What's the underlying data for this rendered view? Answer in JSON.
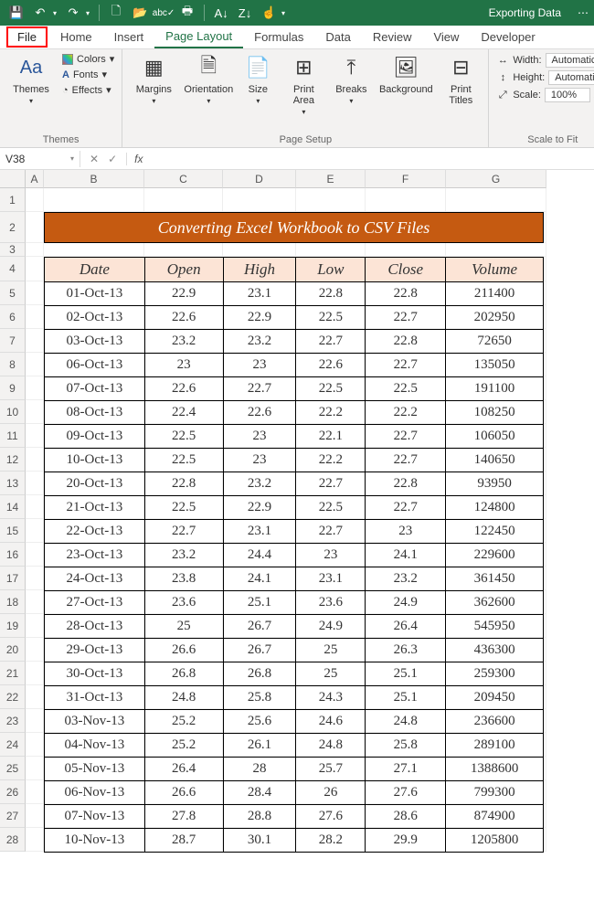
{
  "workbook_name": "Exporting Data",
  "qat": [
    "save",
    "undo",
    "redo",
    "new",
    "open",
    "spellcheck",
    "quickprint",
    "sort-asc",
    "sort-desc",
    "touch",
    "more"
  ],
  "tabs": [
    "File",
    "Home",
    "Insert",
    "Page Layout",
    "Formulas",
    "Data",
    "Review",
    "View",
    "Developer"
  ],
  "active_tab": "Page Layout",
  "highlighted_tab": "File",
  "ribbon": {
    "themes": {
      "label": "Themes",
      "btn": "Themes",
      "colors": "Colors",
      "fonts": "Fonts",
      "effects": "Effects"
    },
    "page_setup": {
      "label": "Page Setup",
      "margins": "Margins",
      "orientation": "Orientation",
      "size": "Size",
      "print_area": "Print Area",
      "breaks": "Breaks",
      "background": "Background",
      "print_titles": "Print Titles"
    },
    "scale_fit": {
      "label": "Scale to Fit",
      "width": "Width:",
      "height": "Height:",
      "scale": "Scale:",
      "width_v": "Automatic",
      "height_v": "Automatic",
      "scale_v": "100%"
    }
  },
  "name_box": "V38",
  "col_headers": [
    "A",
    "B",
    "C",
    "D",
    "E",
    "F",
    "G"
  ],
  "row_headers": [
    1,
    2,
    3,
    4,
    5,
    6,
    7,
    8,
    9,
    10,
    11,
    12,
    13,
    14,
    15,
    16,
    17,
    18,
    19,
    20,
    21,
    22,
    23,
    24,
    25,
    26,
    27,
    28
  ],
  "banner": "Converting Excel Workbook to CSV Files",
  "table": {
    "headers": [
      "Date",
      "Open",
      "High",
      "Low",
      "Close",
      "Volume"
    ],
    "rows": [
      [
        "01-Oct-13",
        "22.9",
        "23.1",
        "22.8",
        "22.8",
        "211400"
      ],
      [
        "02-Oct-13",
        "22.6",
        "22.9",
        "22.5",
        "22.7",
        "202950"
      ],
      [
        "03-Oct-13",
        "23.2",
        "23.2",
        "22.7",
        "22.8",
        "72650"
      ],
      [
        "06-Oct-13",
        "23",
        "23",
        "22.6",
        "22.7",
        "135050"
      ],
      [
        "07-Oct-13",
        "22.6",
        "22.7",
        "22.5",
        "22.5",
        "191100"
      ],
      [
        "08-Oct-13",
        "22.4",
        "22.6",
        "22.2",
        "22.2",
        "108250"
      ],
      [
        "09-Oct-13",
        "22.5",
        "23",
        "22.1",
        "22.7",
        "106050"
      ],
      [
        "10-Oct-13",
        "22.5",
        "23",
        "22.2",
        "22.7",
        "140650"
      ],
      [
        "20-Oct-13",
        "22.8",
        "23.2",
        "22.7",
        "22.8",
        "93950"
      ],
      [
        "21-Oct-13",
        "22.5",
        "22.9",
        "22.5",
        "22.7",
        "124800"
      ],
      [
        "22-Oct-13",
        "22.7",
        "23.1",
        "22.7",
        "23",
        "122450"
      ],
      [
        "23-Oct-13",
        "23.2",
        "24.4",
        "23",
        "24.1",
        "229600"
      ],
      [
        "24-Oct-13",
        "23.8",
        "24.1",
        "23.1",
        "23.2",
        "361450"
      ],
      [
        "27-Oct-13",
        "23.6",
        "25.1",
        "23.6",
        "24.9",
        "362600"
      ],
      [
        "28-Oct-13",
        "25",
        "26.7",
        "24.9",
        "26.4",
        "545950"
      ],
      [
        "29-Oct-13",
        "26.6",
        "26.7",
        "25",
        "26.3",
        "436300"
      ],
      [
        "30-Oct-13",
        "26.8",
        "26.8",
        "25",
        "25.1",
        "259300"
      ],
      [
        "31-Oct-13",
        "24.8",
        "25.8",
        "24.3",
        "25.1",
        "209450"
      ],
      [
        "03-Nov-13",
        "25.2",
        "25.6",
        "24.6",
        "24.8",
        "236600"
      ],
      [
        "04-Nov-13",
        "25.2",
        "26.1",
        "24.8",
        "25.8",
        "289100"
      ],
      [
        "05-Nov-13",
        "26.4",
        "28",
        "25.7",
        "27.1",
        "1388600"
      ],
      [
        "06-Nov-13",
        "26.6",
        "28.4",
        "26",
        "27.6",
        "799300"
      ],
      [
        "07-Nov-13",
        "27.8",
        "28.8",
        "27.6",
        "28.6",
        "874900"
      ],
      [
        "10-Nov-13",
        "28.7",
        "30.1",
        "28.2",
        "29.9",
        "1205800"
      ]
    ]
  }
}
